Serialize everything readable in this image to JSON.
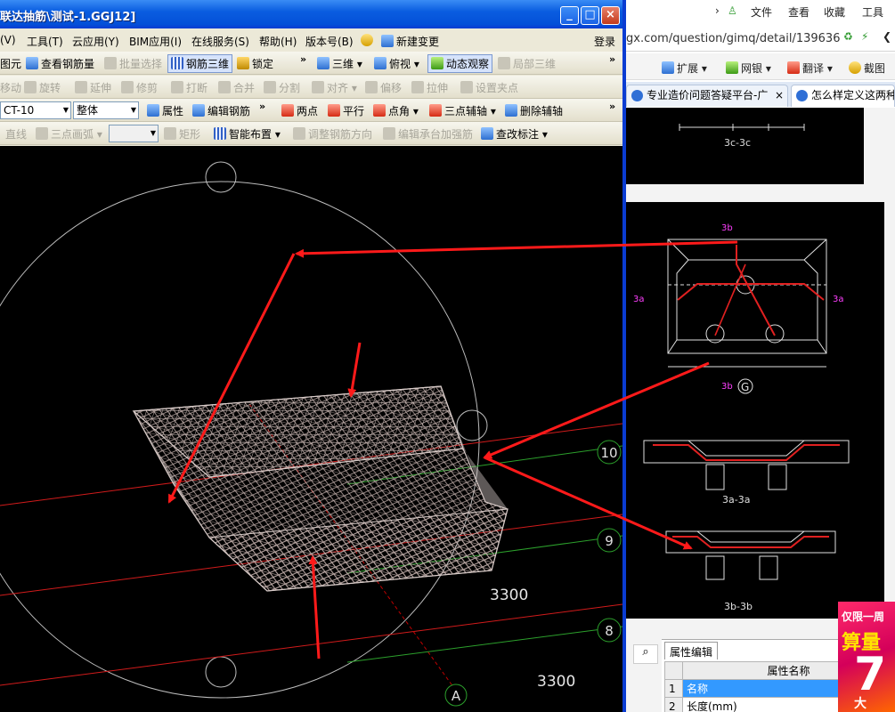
{
  "app": {
    "title": "联达抽筋\\测试-1.GGJ12]",
    "menu": [
      {
        "label": "(V)"
      },
      {
        "label": "工具(T)"
      },
      {
        "label": "云应用(Y)"
      },
      {
        "label": "BIM应用(I)"
      },
      {
        "label": "在线服务(S)"
      },
      {
        "label": "帮助(H)"
      },
      {
        "label": "版本号(B)"
      },
      {
        "label": "新建变更"
      },
      {
        "label": "登录"
      }
    ],
    "toolbar1": {
      "figure_element": "图元",
      "view_rebar_qty": "查看钢筋量",
      "batch_select": "批量选择",
      "rebar_3d": "钢筋三维",
      "lock": "锁定",
      "three_d": "三维",
      "top_view": "俯视",
      "dynamic_observe": "动态观察",
      "local_3d": "局部三维"
    },
    "toolbar2": {
      "move": "移动",
      "rotate": "旋转",
      "extend": "延伸",
      "trim": "修剪",
      "break": "打断",
      "merge": "合并",
      "split": "分割",
      "align": "对齐",
      "offset": "偏移",
      "stretch": "拉伸",
      "set_pin": "设置夹点"
    },
    "toolbar3": {
      "component_select": "CT-10",
      "layer_select": "整体",
      "properties": "属性",
      "edit_rebar": "编辑钢筋",
      "two_points": "两点",
      "parallel": "平行",
      "point_angle": "点角",
      "three_point_axis": "三点辅轴",
      "delete_axis": "删除辅轴"
    },
    "toolbar4": {
      "line": "直线",
      "three_point_arc": "三点画弧",
      "rectangle": "矩形",
      "smart_layout": "智能布置",
      "adjust_rebar_direction": "调整钢筋方向",
      "edit_pile_cap_rebar": "编辑承台加强筋",
      "modify_annotation": "查改标注"
    },
    "viewport": {
      "axis_labels": [
        "10",
        "9",
        "8",
        "A"
      ],
      "dimensions": [
        "3300",
        "3300"
      ]
    }
  },
  "browser": {
    "menu": [
      "文件",
      "查看",
      "收藏",
      "工具"
    ],
    "url_visible": "gx.com/question/gimq/detail/139636",
    "bookmarks": [
      "扩展",
      "网银",
      "翻译",
      "截图"
    ],
    "tabs": [
      {
        "title": "专业造价问题答疑平台-广",
        "active": false
      },
      {
        "title": "怎么样定义这两种",
        "active": true
      }
    ],
    "drawing": {
      "top_label": "3c-3c",
      "plan_label": "G",
      "section1_label": "3a-3a",
      "section2_label": "3b-3b",
      "side_marks": [
        "3a",
        "3a",
        "3b",
        "3b"
      ]
    },
    "property_panel": {
      "tab": "属性编辑",
      "header": "属性名称",
      "rows": [
        {
          "index": "1",
          "name": "名称"
        },
        {
          "index": "2",
          "name": "长度(mm)"
        }
      ]
    },
    "ad": {
      "line1": "仅限一周",
      "line2": "算量",
      "line3": "7",
      "line4": "大"
    }
  },
  "colors": {
    "title_bar": "#0a5de0",
    "annotation_arrow": "#ff1a1a",
    "viewport_bg": "#000000",
    "drawing_bg": "#000000"
  }
}
